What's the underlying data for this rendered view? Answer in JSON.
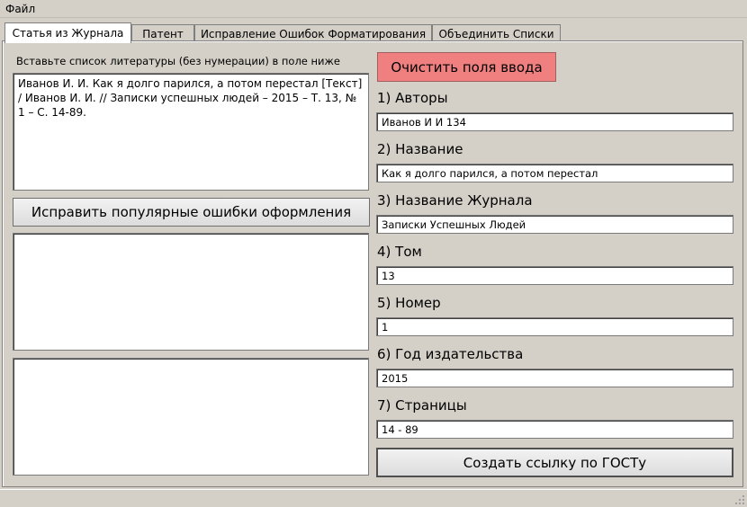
{
  "menu": {
    "file": "Файл"
  },
  "tabs": [
    {
      "label": "Статья из Журнала"
    },
    {
      "label": "Патент"
    },
    {
      "label": "Исправление Ошибок Форматирования"
    },
    {
      "label": "Объединить Списки"
    }
  ],
  "left": {
    "instruction": "Вставьте список литературы (без нумерации) в поле ниже",
    "input_text": "Иванов И. И. Как я долго парился, а потом перестал [Текст] / Иванов И. И. // Записки успешных людей – 2015 – Т. 13, № 1 – С. 14-89.",
    "fix_button": "Исправить популярные ошибки оформления",
    "output_text_1": "",
    "output_text_2": ""
  },
  "right": {
    "clear_button": "Очистить поля ввода",
    "fields": [
      {
        "label": "1) Авторы",
        "value": "Иванов И И 134"
      },
      {
        "label": "2) Название",
        "value": "Как я долго парился, а потом перестал"
      },
      {
        "label": "3) Название Журнала",
        "value": "Записки Успешных Людей"
      },
      {
        "label": "4) Том",
        "value": "13"
      },
      {
        "label": "5) Номер",
        "value": "1"
      },
      {
        "label": "6) Год издательства",
        "value": "2015"
      },
      {
        "label": "7) Страницы",
        "value": "14 - 89"
      }
    ],
    "create_button": "Создать ссылку по ГОСТу"
  },
  "colors": {
    "window_bg": "#d4d0c8",
    "clear_button_bg": "#f08080",
    "field_bg": "#ffffff"
  }
}
